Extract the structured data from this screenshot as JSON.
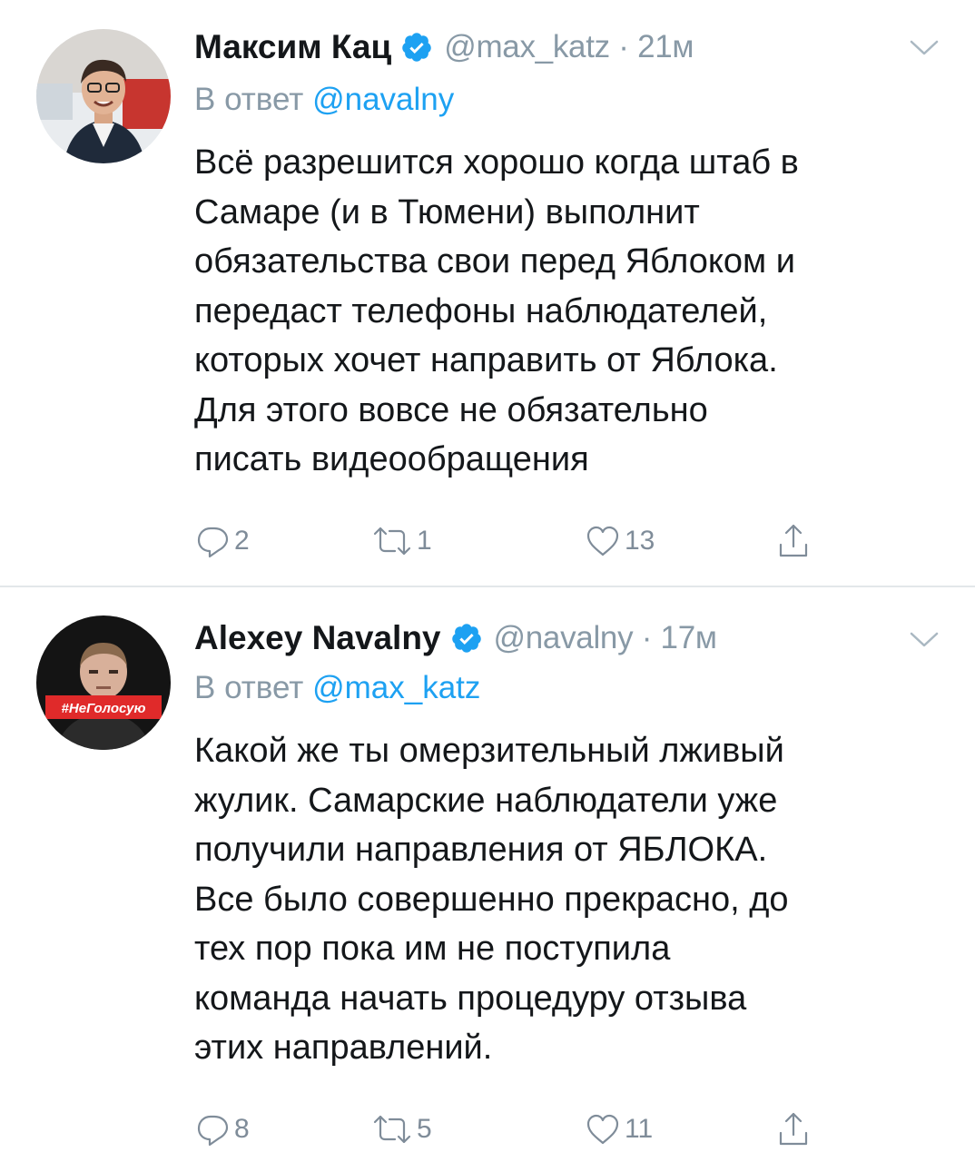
{
  "tweets": [
    {
      "author": "Максим Кац",
      "handle": "@max_katz",
      "separator": "·",
      "time": "21м",
      "reply_prefix": "В ответ",
      "reply_to": "@navalny",
      "text_lines": [
        "Всё разрешится хорошо когда штаб в",
        "Самаре (и в Тюмени) выполнит",
        "обязательства свои перед Яблоком и",
        "передаст телефоны наблюдателей,",
        "которых хочет направить от Яблока.",
        "Для этого вовсе не обязательно",
        "писать видеообращения"
      ],
      "replies": "2",
      "retweets": "1",
      "likes": "13"
    },
    {
      "author": "Alexey Navalny",
      "handle": "@navalny",
      "separator": "·",
      "time": "17м",
      "reply_prefix": "В ответ",
      "reply_to": "@max_katz",
      "avatar_badge": "#НеГолосую",
      "text_lines": [
        "Какой же ты омерзительный лживый",
        "жулик. Самарские наблюдатели уже",
        "получили направления от ЯБЛОКА.",
        "Все было совершенно прекрасно, до",
        "тех пор пока им не поступила",
        "команда начать процедуру отзыва",
        "этих направлений."
      ],
      "replies": "8",
      "retweets": "5",
      "likes": "11"
    }
  ],
  "colors": {
    "text": "#14171a",
    "secondary": "#8899a6",
    "link": "#1da1f2",
    "verified": "#1da1f2",
    "divider": "#e3e7ea"
  },
  "icons": [
    "verified-badge-icon",
    "chevron-down-icon",
    "reply-icon",
    "retweet-icon",
    "like-icon",
    "share-icon"
  ]
}
